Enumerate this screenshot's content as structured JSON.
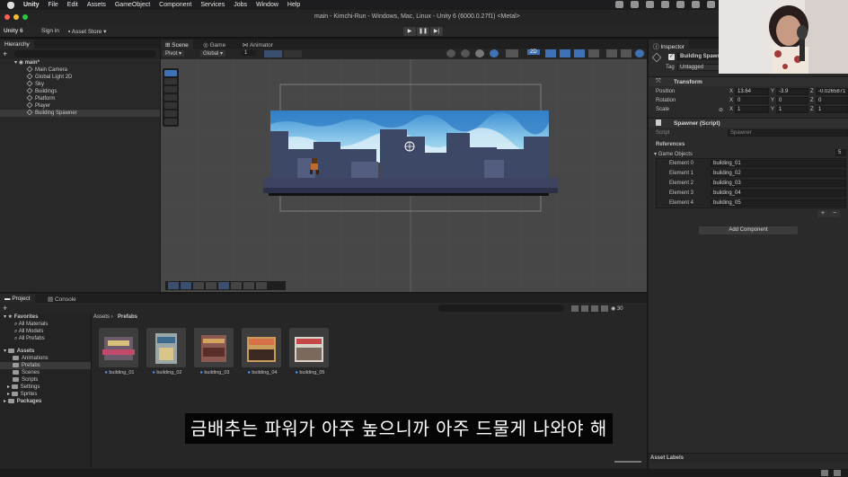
{
  "menubar": {
    "app": "Unity",
    "items": [
      "File",
      "Edit",
      "Assets",
      "GameObject",
      "Component",
      "Services",
      "Jobs",
      "Window",
      "Help"
    ]
  },
  "window_title": "main - Kimchi-Run - Windows, Mac, Linux - Unity 6 (6000.0.27f1) <Metal>",
  "toolbar": {
    "account": "Unity 6",
    "sign_in": "Sign in",
    "asset_store": "Asset Store"
  },
  "hierarchy": {
    "tab": "Hierarchy",
    "scene": "main*",
    "objects": [
      "Main Camera",
      "Global Light 2D",
      "Sky",
      "Buildings",
      "Platform",
      "Player",
      "Building Spawner"
    ],
    "selected": "Building Spawner"
  },
  "scene": {
    "tabs": [
      "Scene",
      "Game",
      "Animator"
    ],
    "pivot": "Pivot",
    "space": "Global",
    "snap": "1",
    "mode_2d": "2D"
  },
  "inspector": {
    "tab": "Inspector",
    "object_name": "Building Spawner",
    "tag_label": "Tag",
    "tag": "Untagged",
    "transform": {
      "title": "Transform",
      "position_label": "Position",
      "position": {
        "x": "13.64",
        "y": "-3.9",
        "z": "-0.0265871"
      },
      "rotation_label": "Rotation",
      "rotation": {
        "x": "0",
        "y": "0",
        "z": "0"
      },
      "scale_label": "Scale",
      "scale": {
        "x": "1",
        "y": "1",
        "z": "1"
      }
    },
    "script_component": {
      "title": "Spawner (Script)",
      "script_label": "Script",
      "script_value": "Spawner",
      "references_label": "References",
      "list_label": "Game Objects",
      "count": "5",
      "elements": [
        {
          "label": "Element 0",
          "value": "building_01"
        },
        {
          "label": "Element 1",
          "value": "building_02"
        },
        {
          "label": "Element 2",
          "value": "building_03"
        },
        {
          "label": "Element 3",
          "value": "building_04"
        },
        {
          "label": "Element 4",
          "value": "building_05"
        }
      ]
    },
    "add_component": "Add Component",
    "asset_labels": "Asset Labels"
  },
  "project": {
    "tabs": [
      "Project",
      "Console"
    ],
    "breadcrumb": [
      "Assets",
      "Prefabs"
    ],
    "favorites": {
      "label": "Favorites",
      "items": [
        "All Materials",
        "All Models",
        "All Prefabs"
      ]
    },
    "assets": {
      "label": "Assets",
      "folders": [
        "Animations",
        "Prefabs",
        "Scenes",
        "Scripts",
        "Settings",
        "Sprites"
      ],
      "selected": "Prefabs"
    },
    "packages": "Packages",
    "prefabs": [
      "building_01",
      "building_02",
      "building_03",
      "building_04",
      "building_05"
    ],
    "count": "30"
  },
  "subtitle": "금배추는 파워가 아주 높으니까 아주 드물게 나와야 해",
  "colors": {
    "sky_top": "#4f9ed8",
    "sky_light": "#bfe3f2",
    "building": "#3d4766",
    "platform": "#3e4361",
    "selection": "#3a3a3a"
  }
}
